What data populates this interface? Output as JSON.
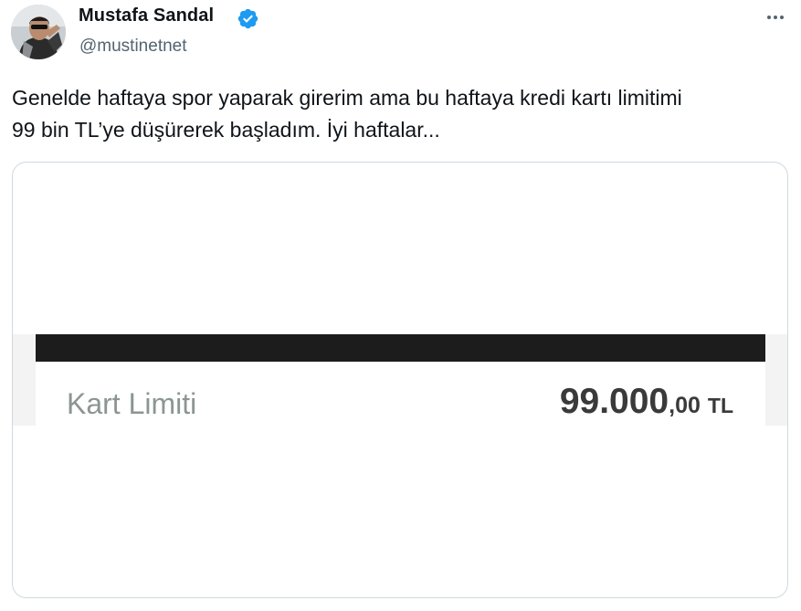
{
  "author": {
    "display_name": "Mustafa Sandal",
    "handle": "@mustinetnet",
    "avatar_icon": "avatar-photo",
    "verified_icon": "verified-badge-icon",
    "verified_color": "#1d9bf0"
  },
  "more_icon": "more-options-icon",
  "tweet": {
    "text_line1": "Genelde haftaya spor yaparak girerim ama bu haftaya kredi kartı limitimi",
    "text_line2": "99 bin TL’ye düşürerek başladım. İyi haftalar..."
  },
  "media": {
    "limit_label": "Kart Limiti",
    "limit_value_main": "99.000",
    "limit_value_decimals": ",00",
    "limit_currency": "TL"
  },
  "colors": {
    "text_primary": "#0f1419",
    "text_secondary": "#536471",
    "border": "#cfd9de"
  }
}
